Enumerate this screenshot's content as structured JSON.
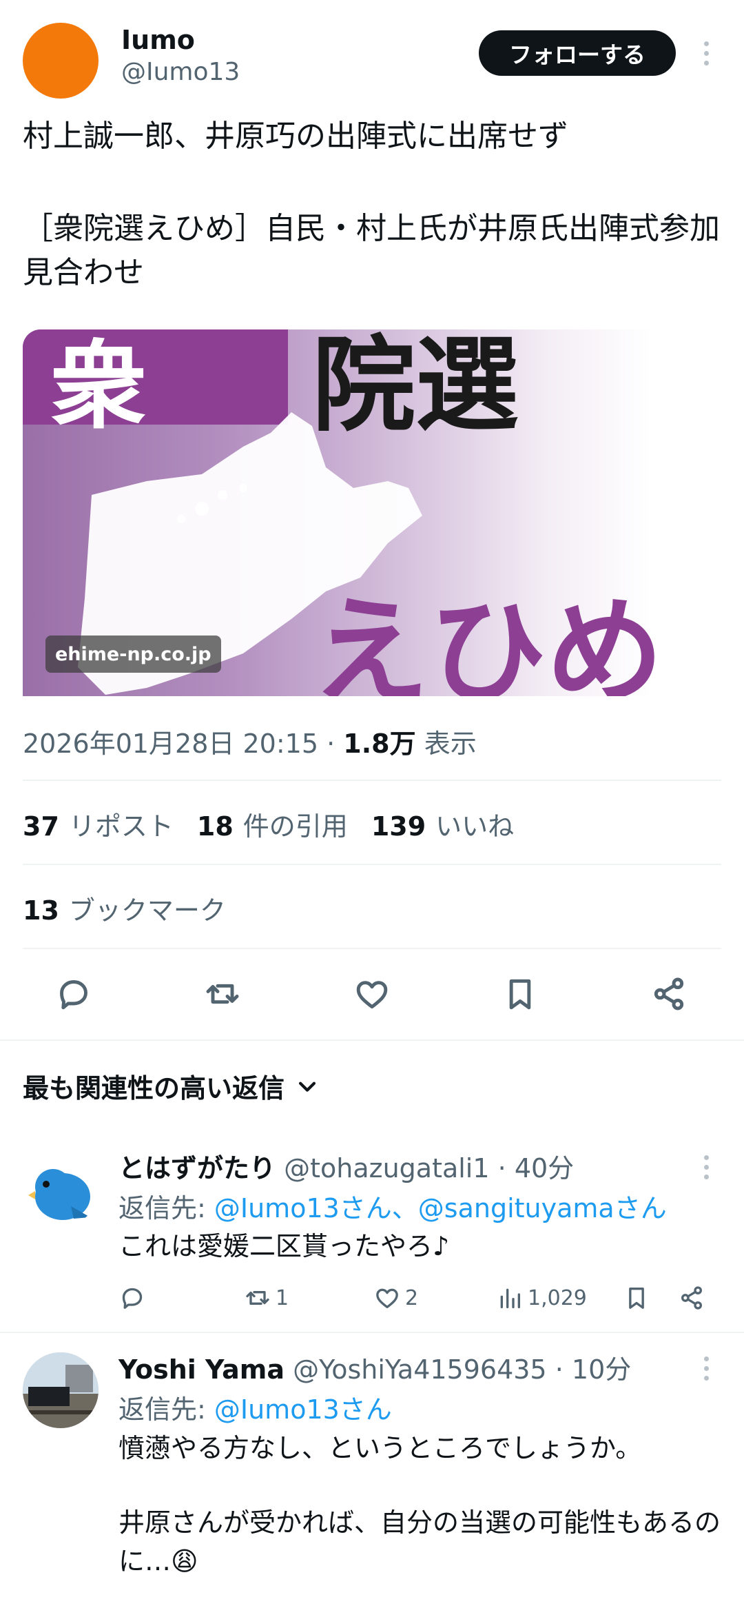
{
  "tweet": {
    "author_name": "Iumo",
    "author_handle": "@Iumo13",
    "follow_label": "フォローする",
    "text_line1": "村上誠一郎、井原巧の出陣式に出席せず",
    "text_line2": "［衆院選えひめ］自民・村上氏が井原氏出陣式参加見合わせ",
    "card_source": "ehime-np.co.jp",
    "card_graphic_text": "衆院選えひめ",
    "timestamp": "2026年01月28日 20:15",
    "separator": "·",
    "views_count": "1.8万",
    "views_label": "表示",
    "reposts_count": "37",
    "reposts_label": "リポスト",
    "quotes_count": "18",
    "quotes_label": "件の引用",
    "likes_count": "139",
    "likes_label": "いいね",
    "bookmarks_count": "13",
    "bookmarks_label": "ブックマーク"
  },
  "actions": {
    "icons": [
      "reply-icon",
      "repost-icon",
      "like-icon",
      "bookmark-icon",
      "share-icon"
    ]
  },
  "replies_section": {
    "sort_label": "最も関連性の高い返信"
  },
  "replies": [
    {
      "name": "とはずがたり",
      "handle": "@tohazugatali1",
      "time": "40分",
      "reply_to_prefix": "返信先: ",
      "reply_to_mentions": "@Iumo13さん、@sangituyamaさん",
      "text": "これは愛媛二区貰ったやろ♪",
      "reposts": "1",
      "likes": "2",
      "views": "1,029"
    },
    {
      "name": "Yoshi Yama",
      "handle": "@YoshiYa41596435",
      "time": "10分",
      "reply_to_prefix": "返信先: ",
      "reply_to_mentions": "@Iumo13さん",
      "text_para1": "憤懣やる方なし、というところでしょうか。",
      "text_para2": "井原さんが受かれば、自分の当選の可能性もあるのに…😩"
    }
  ],
  "colors": {
    "accent": "#1d9bf0",
    "text": "#0f1419",
    "muted": "#536471",
    "divider": "#eff3f4",
    "avatar_orange": "#f4790b",
    "card_purple": "#8d3f94"
  }
}
